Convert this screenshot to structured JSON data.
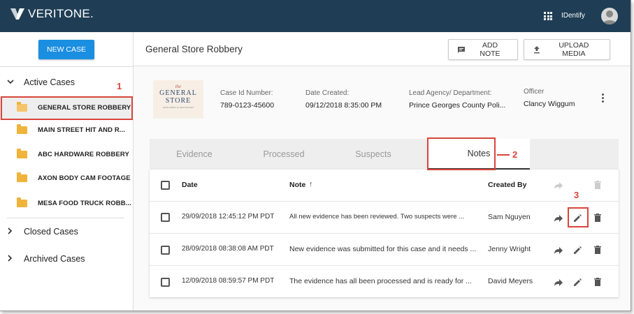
{
  "brand": {
    "logo_text": "VERITONE."
  },
  "topbar": {
    "app_name": "IDentify"
  },
  "sidebar": {
    "new_case_label": "NEW CASE",
    "active_cases_label": "Active Cases",
    "closed_cases_label": "Closed Cases",
    "archived_cases_label": "Archived Cases",
    "cases": [
      {
        "label": "GENERAL STORE ROBBERY"
      },
      {
        "label": "MAIN STREET HIT AND R..."
      },
      {
        "label": "ABC HARDWARE ROBBERY"
      },
      {
        "label": "AXON BODY CAM FOOTAGE"
      },
      {
        "label": "MESA FOOD TRUCK ROBB..."
      }
    ]
  },
  "header": {
    "title": "General Store Robbery",
    "add_note_label": "ADD NOTE",
    "upload_media_label": "UPLOAD MEDIA"
  },
  "case_logo": {
    "line1": "the",
    "line2": "GENERAL",
    "line3": "STORE",
    "line4": "GROCERIES & PROVISIONS"
  },
  "case_info": {
    "case_id_label": "Case Id Number:",
    "case_id_value": "789-0123-45600",
    "date_created_label": "Date Created:",
    "date_created_value": "09/12/2018 8:35:00 PM",
    "lead_agency_label": "Lead Agency/ Department:",
    "lead_agency_value": "Prince Georges County Poli...",
    "officer_label": "Officer",
    "officer_value": "Clancy Wiggum"
  },
  "tabs": [
    {
      "label": "Evidence"
    },
    {
      "label": "Processed"
    },
    {
      "label": "Suspects"
    },
    {
      "label": "Notes"
    }
  ],
  "table": {
    "columns": {
      "date": "Date",
      "note": "Note",
      "sort_arrow": "↑",
      "created_by": "Created By"
    },
    "rows": [
      {
        "date": "29/09/2018 12:45:12 PM PDT",
        "note": "All new evidence has been reviewed. Two suspects were ...",
        "created_by": "Sam Nguyen"
      },
      {
        "date": "28/09/2018 08:38:08 AM PDT",
        "note": "New evidence was submitted for this case and it needs ...",
        "created_by": "Jenny Wright"
      },
      {
        "date": "12/09/2018 08:59:57 PM PDT",
        "note": "The evidence has all been processed and is ready for ...",
        "created_by": "David Meyers"
      }
    ]
  },
  "annotations": {
    "n1": "1",
    "n2": "2",
    "n3": "3"
  },
  "colors": {
    "topbar": "#1f3e55",
    "primary_button": "#1a8ee1",
    "annotation": "#d9453b",
    "folder": "#f0b43a"
  }
}
